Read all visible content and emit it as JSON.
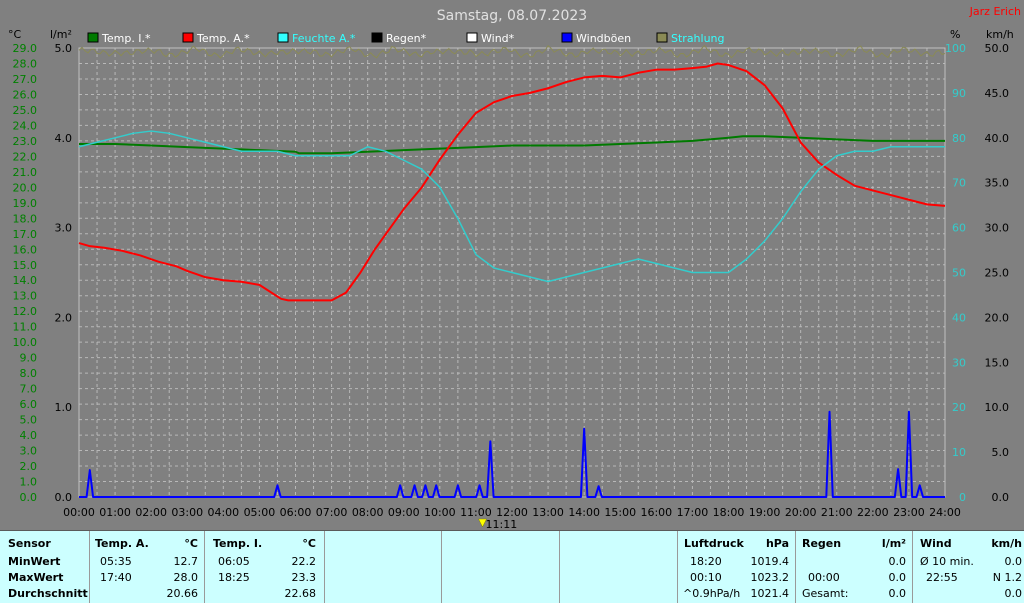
{
  "title": "Samstag, 08.07.2023",
  "author": "Jarz Erich",
  "axis_units": {
    "temp": "°C",
    "rain": "l/m²",
    "humidity": "%",
    "wind": "km/h"
  },
  "current_time_marker": "11:11",
  "colors": {
    "background": "#808080",
    "grid": "#b8b8b8",
    "temp_inner": "#007a00",
    "temp_outer": "#ff0000",
    "humidity": "#33cccc",
    "wind_gust": "#0000ff",
    "radiation": "#8a8a55",
    "title": "#e0e0e0",
    "author": "#ff0000",
    "tick_temp": "#008000",
    "tick_rain": "#000000",
    "tick_humidity": "#33cccc",
    "tick_wind": "#000000"
  },
  "legend": [
    {
      "label": "Temp. I.*",
      "color": "#007a00",
      "text_color": "#ffffff"
    },
    {
      "label": "Temp. A.*",
      "color": "#ff0000",
      "text_color": "#ffffff"
    },
    {
      "label": "Feuchte A.*",
      "color": "#33ffff",
      "text_color": "#33ffff"
    },
    {
      "label": "Regen*",
      "color": "#000000",
      "text_color": "#ffffff"
    },
    {
      "label": "Wind*",
      "color": "#ffffff",
      "text_color": "#ffffff"
    },
    {
      "label": "Windböen",
      "color": "#0000ff",
      "text_color": "#ffffff"
    },
    {
      "label": "Strahlung",
      "color": "#8a8a55",
      "text_color": "#33ffff"
    }
  ],
  "chart_data": {
    "type": "line",
    "title": "Samstag, 08.07.2023",
    "x_ticks": [
      "00:00",
      "01:00",
      "02:00",
      "03:00",
      "04:00",
      "05:00",
      "06:00",
      "07:00",
      "08:00",
      "09:00",
      "10:00",
      "11:00",
      "12:00",
      "13:00",
      "14:00",
      "15:00",
      "16:00",
      "17:00",
      "18:00",
      "19:00",
      "20:00",
      "21:00",
      "22:00",
      "23:00",
      "24:00"
    ],
    "axes": {
      "temp": {
        "min": 0.0,
        "max": 29.0,
        "step": 1.0,
        "unit": "°C"
      },
      "rain": {
        "min": 0.0,
        "max": 5.0,
        "step": 1.0,
        "unit": "l/m²"
      },
      "humidity": {
        "min": 0,
        "max": 100,
        "step": 10,
        "unit": "%"
      },
      "wind": {
        "min": 0.0,
        "max": 50.0,
        "step": 5.0,
        "unit": "km/h"
      }
    },
    "grid": true,
    "series": [
      {
        "name": "Temp. I.*",
        "axis": "temp",
        "color": "#007a00",
        "points": [
          [
            0,
            22.8
          ],
          [
            1,
            22.8
          ],
          [
            2,
            22.7
          ],
          [
            3,
            22.6
          ],
          [
            4,
            22.5
          ],
          [
            5,
            22.4
          ],
          [
            6,
            22.3
          ],
          [
            6.1,
            22.2
          ],
          [
            7,
            22.2
          ],
          [
            8,
            22.3
          ],
          [
            9,
            22.4
          ],
          [
            10,
            22.5
          ],
          [
            11,
            22.6
          ],
          [
            12,
            22.7
          ],
          [
            13,
            22.7
          ],
          [
            14,
            22.7
          ],
          [
            15,
            22.8
          ],
          [
            16,
            22.9
          ],
          [
            17,
            23.0
          ],
          [
            18,
            23.2
          ],
          [
            18.4,
            23.3
          ],
          [
            19,
            23.3
          ],
          [
            20,
            23.2
          ],
          [
            21,
            23.1
          ],
          [
            22,
            23.0
          ],
          [
            23,
            23.0
          ],
          [
            24,
            23.0
          ]
        ]
      },
      {
        "name": "Temp. A.*",
        "axis": "temp",
        "color": "#ff0000",
        "points": [
          [
            0,
            16.4
          ],
          [
            0.3,
            16.2
          ],
          [
            0.7,
            16.1
          ],
          [
            1.2,
            15.9
          ],
          [
            1.7,
            15.6
          ],
          [
            2.2,
            15.2
          ],
          [
            2.7,
            14.9
          ],
          [
            3,
            14.6
          ],
          [
            3.5,
            14.2
          ],
          [
            4,
            14.0
          ],
          [
            4.5,
            13.9
          ],
          [
            5,
            13.7
          ],
          [
            5.6,
            12.8
          ],
          [
            5.8,
            12.7
          ],
          [
            6.2,
            12.7
          ],
          [
            6.6,
            12.7
          ],
          [
            7,
            12.7
          ],
          [
            7.4,
            13.2
          ],
          [
            7.8,
            14.5
          ],
          [
            8.2,
            16.0
          ],
          [
            8.6,
            17.3
          ],
          [
            9,
            18.6
          ],
          [
            9.5,
            20.0
          ],
          [
            10,
            21.8
          ],
          [
            10.5,
            23.4
          ],
          [
            11,
            24.8
          ],
          [
            11.5,
            25.5
          ],
          [
            12,
            25.9
          ],
          [
            12.5,
            26.1
          ],
          [
            13,
            26.4
          ],
          [
            13.5,
            26.8
          ],
          [
            14,
            27.1
          ],
          [
            14.5,
            27.2
          ],
          [
            15,
            27.1
          ],
          [
            15.5,
            27.4
          ],
          [
            16,
            27.6
          ],
          [
            16.5,
            27.6
          ],
          [
            17,
            27.7
          ],
          [
            17.4,
            27.8
          ],
          [
            17.7,
            28.0
          ],
          [
            18,
            27.9
          ],
          [
            18.5,
            27.5
          ],
          [
            19,
            26.6
          ],
          [
            19.5,
            25.1
          ],
          [
            20,
            22.9
          ],
          [
            20.5,
            21.6
          ],
          [
            21,
            20.8
          ],
          [
            21.5,
            20.1
          ],
          [
            22,
            19.8
          ],
          [
            22.5,
            19.5
          ],
          [
            23,
            19.2
          ],
          [
            23.5,
            18.9
          ],
          [
            24,
            18.8
          ]
        ]
      },
      {
        "name": "Feuchte A.*",
        "axis": "humidity",
        "color": "#33cccc",
        "points": [
          [
            0,
            78
          ],
          [
            0.5,
            79
          ],
          [
            1,
            80
          ],
          [
            1.5,
            81
          ],
          [
            2,
            81.5
          ],
          [
            2.5,
            81
          ],
          [
            3,
            80
          ],
          [
            3.5,
            79
          ],
          [
            4,
            78
          ],
          [
            4.5,
            77
          ],
          [
            5,
            77
          ],
          [
            5.5,
            77
          ],
          [
            6,
            76
          ],
          [
            6.5,
            76
          ],
          [
            7,
            76
          ],
          [
            7.5,
            76
          ],
          [
            8,
            78
          ],
          [
            8.5,
            77
          ],
          [
            9,
            75
          ],
          [
            9.5,
            73
          ],
          [
            10,
            69
          ],
          [
            10.5,
            62
          ],
          [
            11,
            54
          ],
          [
            11.5,
            51
          ],
          [
            12,
            50
          ],
          [
            12.5,
            49
          ],
          [
            13,
            48
          ],
          [
            13.5,
            49
          ],
          [
            14,
            50
          ],
          [
            14.5,
            51
          ],
          [
            15,
            52
          ],
          [
            15.5,
            53
          ],
          [
            16,
            52
          ],
          [
            16.5,
            51
          ],
          [
            17,
            50
          ],
          [
            17.5,
            50
          ],
          [
            18,
            50
          ],
          [
            18.5,
            53
          ],
          [
            19,
            57
          ],
          [
            19.5,
            62
          ],
          [
            20,
            68
          ],
          [
            20.5,
            73
          ],
          [
            21,
            76
          ],
          [
            21.5,
            77
          ],
          [
            22,
            77
          ],
          [
            22.5,
            78
          ],
          [
            23,
            78
          ],
          [
            23.5,
            78
          ],
          [
            24,
            78
          ]
        ]
      },
      {
        "name": "Strahlung",
        "axis": "humidity",
        "color": "#8a8a55",
        "noise": true,
        "points": [
          [
            0,
            99.5
          ],
          [
            24,
            99.5
          ]
        ]
      },
      {
        "name": "Windböen",
        "axis": "wind",
        "color": "#0000ff",
        "spikes": [
          [
            0.3,
            3.0
          ],
          [
            5.5,
            1.3
          ],
          [
            8.9,
            1.3
          ],
          [
            9.3,
            1.3
          ],
          [
            9.6,
            1.3
          ],
          [
            9.9,
            1.3
          ],
          [
            10.5,
            1.3
          ],
          [
            11.1,
            1.3
          ],
          [
            11.4,
            6.2
          ],
          [
            14.0,
            7.6
          ],
          [
            14.4,
            1.2
          ],
          [
            20.8,
            9.5
          ],
          [
            22.7,
            3.1
          ],
          [
            23.0,
            9.5
          ],
          [
            23.3,
            1.3
          ]
        ]
      }
    ]
  },
  "stats": {
    "sensor_col": {
      "header": "Sensor",
      "rows": [
        "MinWert",
        "MaxWert",
        "Durchschnitt"
      ]
    },
    "temp_outdoor": {
      "header": "Temp. A.",
      "unit": "°C",
      "min_time": "05:35",
      "min_val": "12.7",
      "max_time": "17:40",
      "max_val": "28.0",
      "avg": "20.66"
    },
    "temp_indoor": {
      "header": "Temp. I.",
      "unit": "°C",
      "min_time": "06:05",
      "min_val": "22.2",
      "max_time": "18:25",
      "max_val": "23.3",
      "avg": "22.68"
    },
    "pressure": {
      "header": "Luftdruck",
      "unit": "hPa",
      "r1_time": "18:20",
      "r1_val": "1019.4",
      "r2_time": "00:10",
      "r2_val": "1023.2",
      "r3_label": "^0.9hPa/h",
      "r3_val": "1021.4"
    },
    "rain": {
      "header": "Regen",
      "unit": "l/m²",
      "r1_val": "0.0",
      "r2_time": "00:00",
      "r2_val": "0.0",
      "r3_label": "Gesamt:",
      "r3_val": "0.0"
    },
    "wind": {
      "header": "Wind",
      "unit": "km/h",
      "r1_label": "Ø 10 min.",
      "r1_val": "0.0",
      "r2_time": "22:55",
      "r2_val": "N 1.2",
      "r3_val": "0.0"
    }
  }
}
